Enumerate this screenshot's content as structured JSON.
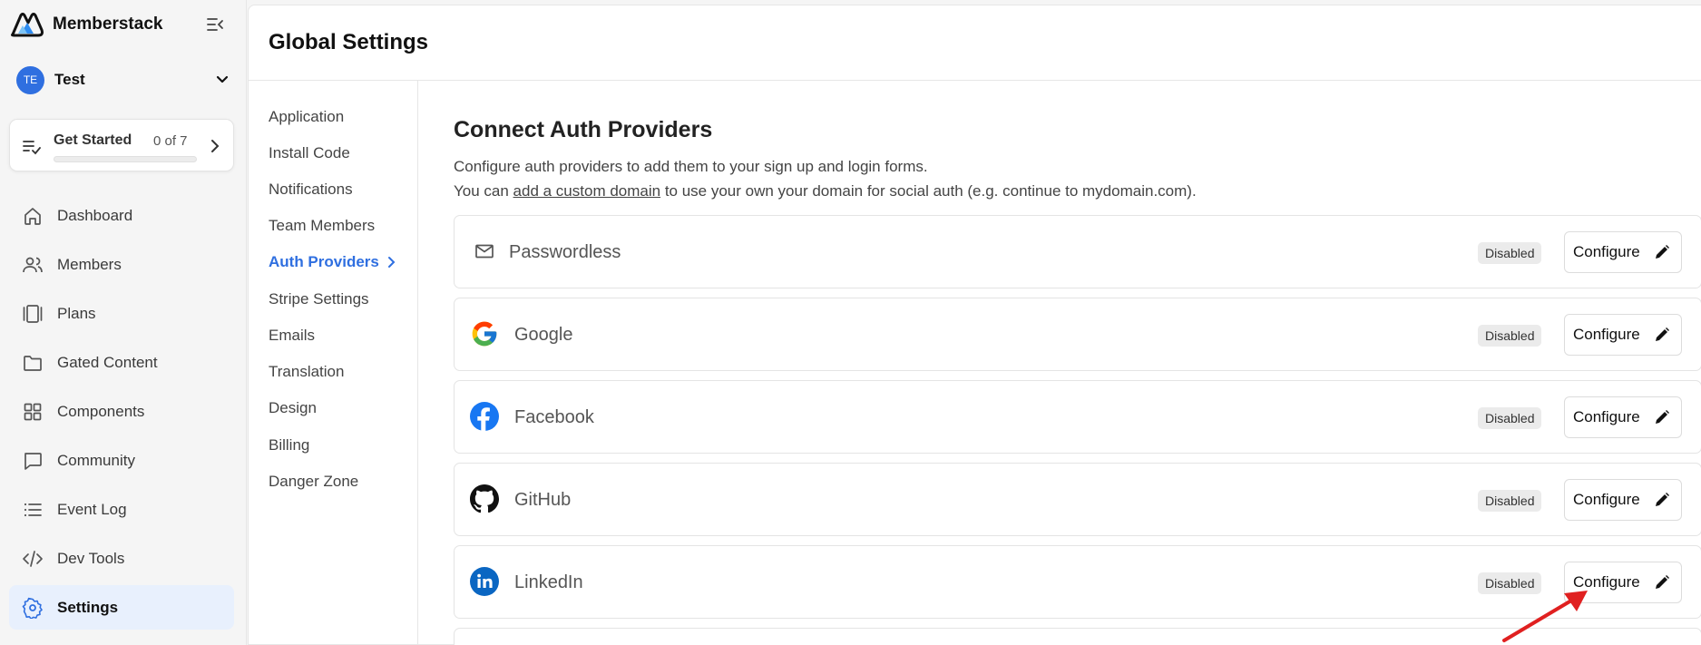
{
  "brand": {
    "name": "Memberstack",
    "accent": "#2f6fe0"
  },
  "workspace": {
    "initials": "TE",
    "name": "Test"
  },
  "get_started": {
    "title": "Get Started",
    "progress_text": "0 of 7",
    "progress": 0
  },
  "nav": [
    {
      "label": "Dashboard",
      "icon": "home-icon"
    },
    {
      "label": "Members",
      "icon": "users-icon"
    },
    {
      "label": "Plans",
      "icon": "plans-icon"
    },
    {
      "label": "Gated Content",
      "icon": "folder-icon"
    },
    {
      "label": "Components",
      "icon": "grid-icon"
    },
    {
      "label": "Community",
      "icon": "chat-icon"
    },
    {
      "label": "Event Log",
      "icon": "list-icon"
    },
    {
      "label": "Dev Tools",
      "icon": "code-icon"
    },
    {
      "label": "Settings",
      "icon": "gear-icon",
      "active": true
    }
  ],
  "page": {
    "title": "Global Settings"
  },
  "subnav": [
    {
      "label": "Application"
    },
    {
      "label": "Install Code"
    },
    {
      "label": "Notifications"
    },
    {
      "label": "Team Members"
    },
    {
      "label": "Auth Providers",
      "active": true
    },
    {
      "label": "Stripe Settings"
    },
    {
      "label": "Emails"
    },
    {
      "label": "Translation"
    },
    {
      "label": "Design"
    },
    {
      "label": "Billing"
    },
    {
      "label": "Danger Zone"
    }
  ],
  "content": {
    "title": "Connect Auth Providers",
    "desc1": "Configure auth providers to add them to your sign up and login forms.",
    "desc2_prefix": "You can ",
    "desc2_link": "add a custom domain",
    "desc2_suffix": " to use your own your domain for social auth (e.g. continue to mydomain.com)."
  },
  "providers": [
    {
      "name": "Passwordless",
      "status": "Disabled",
      "button": "Configure",
      "icon": "mail-icon"
    },
    {
      "name": "Google",
      "status": "Disabled",
      "button": "Configure",
      "icon": "google-icon"
    },
    {
      "name": "Facebook",
      "status": "Disabled",
      "button": "Configure",
      "icon": "facebook-icon"
    },
    {
      "name": "GitHub",
      "status": "Disabled",
      "button": "Configure",
      "icon": "github-icon"
    },
    {
      "name": "LinkedIn",
      "status": "Disabled",
      "button": "Configure",
      "icon": "linkedin-icon"
    }
  ],
  "annotation": {
    "arrow_color": "#e02020"
  }
}
